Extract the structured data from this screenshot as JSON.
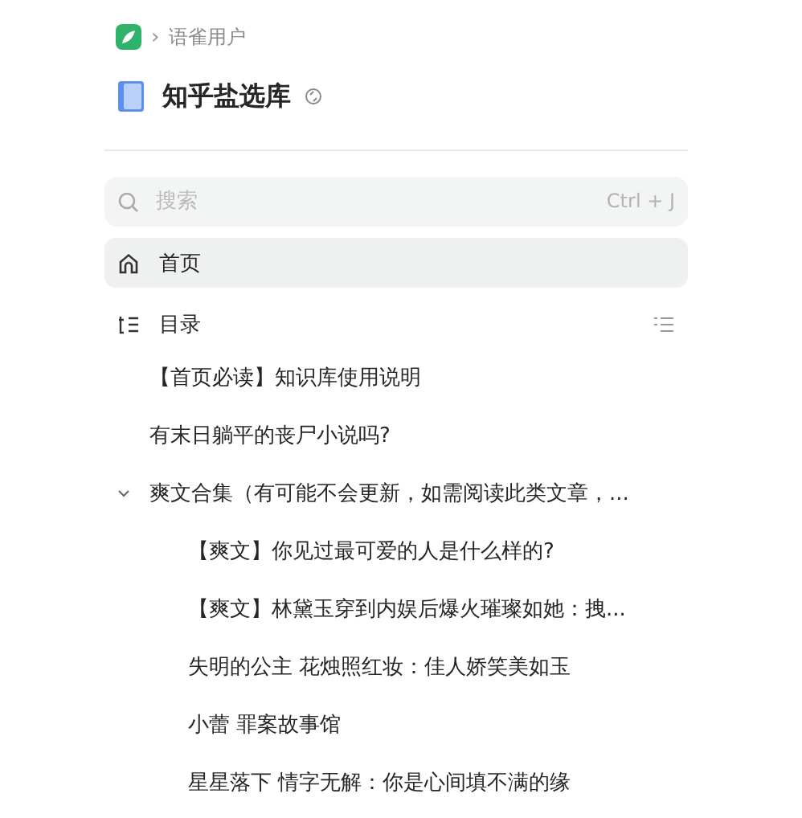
{
  "breadcrumb": {
    "separator": "›",
    "label": "语雀用户"
  },
  "book": {
    "title": "知乎盐选库"
  },
  "search": {
    "placeholder": "搜索",
    "shortcut": "Ctrl + J"
  },
  "nav": [
    {
      "kind": "home",
      "label": "首页",
      "selected": true
    },
    {
      "kind": "toc",
      "label": "目录",
      "selected": false
    }
  ],
  "toc": [
    {
      "title": "【首页必读】知识库使用说明"
    },
    {
      "title": "有末日躺平的丧尸小说吗?"
    },
    {
      "title": "爽文合集（有可能不会更新，如需阅读此类文章，...",
      "expanded": true,
      "children": [
        {
          "title": "【爽文】你见过最可爱的人是什么样的?"
        },
        {
          "title": "【爽文】林黛玉穿到内娱后爆火璀璨如她：拽..."
        },
        {
          "title": "失明的公主 花烛照红妆：佳人娇笑美如玉"
        },
        {
          "title": "小蕾 罪案故事馆"
        },
        {
          "title": "星星落下 情字无解：你是心间填不满的缘"
        }
      ]
    }
  ]
}
